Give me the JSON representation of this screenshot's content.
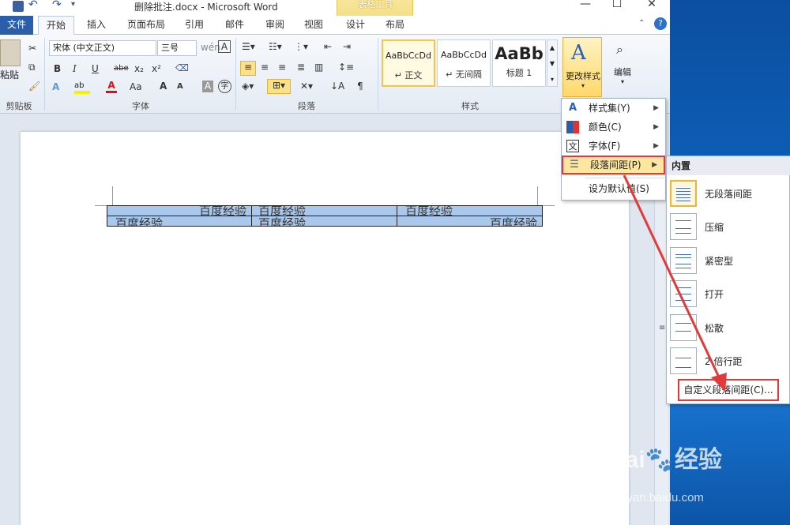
{
  "window": {
    "title": "删除批注.docx - Microsoft Word",
    "context_tab_group": "表格工具",
    "controls": {
      "minimize": "—",
      "maximize": "☐",
      "close": "✕"
    }
  },
  "tabs": [
    "文件",
    "开始",
    "插入",
    "页面布局",
    "引用",
    "邮件",
    "审阅",
    "视图",
    "设计",
    "布局"
  ],
  "ribbon": {
    "clipboard": {
      "paste": "粘贴",
      "group_label": "剪贴板"
    },
    "font": {
      "font_name": "宋体 (中文正文)",
      "font_size": "三号",
      "group_label": "字体",
      "buttons": [
        "B",
        "I",
        "U",
        "abe",
        "x₂",
        "x²",
        "A",
        "Aa",
        "A",
        "A",
        "A",
        "字"
      ]
    },
    "paragraph": {
      "group_label": "段落"
    },
    "styles": {
      "group_label": "样式",
      "items": [
        {
          "preview": "AaBbCcDd",
          "name": "↵ 正文"
        },
        {
          "preview": "AaBbCcDd",
          "name": "↵ 无间隔"
        },
        {
          "preview": "AaBb",
          "name": "标题 1"
        }
      ],
      "change_styles": "更改样式",
      "edit": "编辑"
    }
  },
  "table": {
    "rows": [
      [
        "百度经验",
        "百度经验",
        "百度经验"
      ],
      [
        "百度经验",
        "百度经验",
        "百度经验"
      ]
    ]
  },
  "menu": {
    "items": [
      {
        "label": "样式集(Y)",
        "icon": "style-set-icon"
      },
      {
        "label": "颜色(C)",
        "icon": "color-icon"
      },
      {
        "label": "字体(F)",
        "icon": "font-icon"
      },
      {
        "label": "段落间距(P)",
        "icon": "paragraph-spacing-icon"
      },
      {
        "label": "设为默认值(S)",
        "icon": ""
      }
    ]
  },
  "submenu": {
    "header": "内置",
    "items": [
      "无段落间距",
      "压缩",
      "紧密型",
      "打开",
      "松散",
      "2 倍行距"
    ],
    "custom": "自定义段落间距(C)..."
  },
  "watermark": {
    "brand": "Bai🐾经验",
    "url": "jingyan.baidu.com"
  },
  "colors": {
    "file_tab": "#2b5ea8",
    "highlight_border": "#e23a3a",
    "selection": "#a9c8ec"
  }
}
